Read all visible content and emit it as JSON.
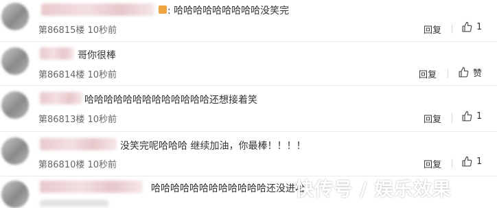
{
  "comments": [
    {
      "text": "哈哈哈哈哈哈哈哈哈没笑完",
      "floor": "第86815楼",
      "time": "10秒前",
      "reply": "回复",
      "like": "1"
    },
    {
      "text": "哥你很棒",
      "floor": "第86814楼",
      "time": "10秒前",
      "reply": "回复",
      "like": "赞"
    },
    {
      "text": "哈哈哈哈哈哈哈哈哈哈哈哈哈还想接着笑",
      "floor": "第86813楼",
      "time": "10秒前",
      "reply": "回复",
      "like": "1"
    },
    {
      "text": "没笑完呢哈哈哈 继续加油，你最棒！！！！",
      "floor": "第86810楼",
      "time": "10秒前",
      "reply": "回复",
      "like": "1"
    },
    {
      "text": "哈哈哈哈哈哈哈哈哈哈哈哈还没进哈",
      "floor": "",
      "time": "",
      "reply": "",
      "like": ""
    }
  ],
  "watermark": "快传号 / 娱乐效果",
  "colors": {
    "badge": "#f0a341",
    "divider": "#ebebeb"
  }
}
